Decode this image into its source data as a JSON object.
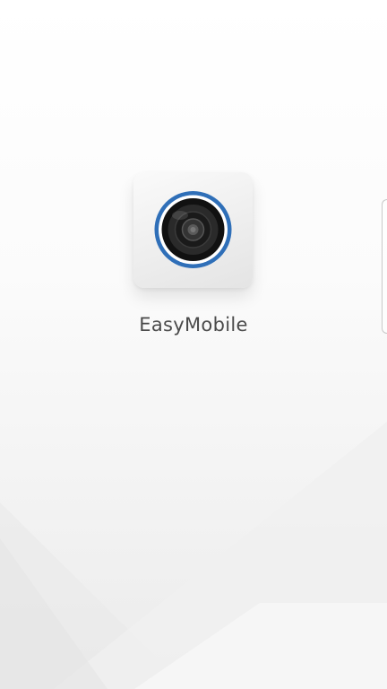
{
  "splash": {
    "app_name": "EasyMobile",
    "app_icon": "camera-lens-icon",
    "accent_color": "#2f6fb8"
  },
  "edge_panel": {
    "icon": "edge-panel-handle"
  }
}
